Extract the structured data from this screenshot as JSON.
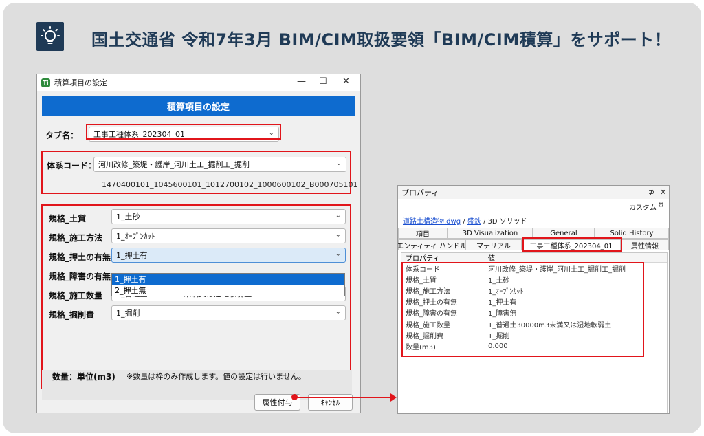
{
  "headline": "国土交通省 令和7年3月 BIM/CIM取扱要領「BIM/CIM積算」をサポート！",
  "colors": {
    "accent": "#0e6bcf",
    "highlight": "#e1151b",
    "headline": "#1f3a56"
  },
  "dialog": {
    "window_title": "積算項目の設定",
    "banner": "積算項目の設定",
    "tab_name_label": "タブ名：",
    "tab_name_value": "工事工種体系_202304_01",
    "code_label": "体系コード：",
    "code_value": "河川改修_築堤・護岸_河川土工_掘削工_掘削",
    "code_number": "1470400101_1045600101_1012700102_1000600102_B000705101",
    "fields": [
      {
        "label": "規格_土質",
        "value": "1_土砂"
      },
      {
        "label": "規格_施工方法",
        "value": "1_ｵｰﾌﾟﾝｶｯﾄ"
      },
      {
        "label": "規格_押土の有無",
        "value": "1_押土有"
      },
      {
        "label": "規格_障害の有無",
        "value": ""
      },
      {
        "label": "規格_施工数量",
        "value": "1_普通土30000m3未満又は湿地軟弱土"
      },
      {
        "label": "規格_掘削費",
        "value": "1_掘削"
      }
    ],
    "dropdown_options": [
      "1_押土有",
      "2_押土無"
    ],
    "qty_label": "数量：単位(m3)",
    "qty_note": "※数量は枠のみ作成します。値の設定は行いません。",
    "apply_button": "属性付与",
    "cancel_button": "ｷｬﾝｾﾙ"
  },
  "palette": {
    "title": "プロパティ",
    "custom": "カスタム",
    "path_file": "道路土構造物.dwg",
    "path_layer": "盛鉄",
    "path_type": "3D ソリッド",
    "tabs_row1": [
      "項目",
      "3D Visualization",
      "General",
      "Solid History"
    ],
    "tabs_row2": [
      "エンティティ ハンドル",
      "マテリアル",
      "工事工種体系_202304_01",
      "属性情報"
    ],
    "col_property": "プロパティ",
    "col_value": "値",
    "rows": [
      {
        "k": "体系コード",
        "v": "河川改修_築堤・護岸_河川土工_掘削工_掘削"
      },
      {
        "k": "規格_土質",
        "v": "1_土砂"
      },
      {
        "k": "規格_施工方法",
        "v": "1_ｵｰﾌﾟﾝｶｯﾄ"
      },
      {
        "k": "規格_押土の有無",
        "v": "1_押土有"
      },
      {
        "k": "規格_障害の有無",
        "v": "1_障害無"
      },
      {
        "k": "規格_施工数量",
        "v": "1_普通土30000m3未満又は湿地軟弱土"
      },
      {
        "k": "規格_掘削費",
        "v": "1_掘削"
      },
      {
        "k": "数量(m3)",
        "v": "0.000"
      }
    ]
  }
}
